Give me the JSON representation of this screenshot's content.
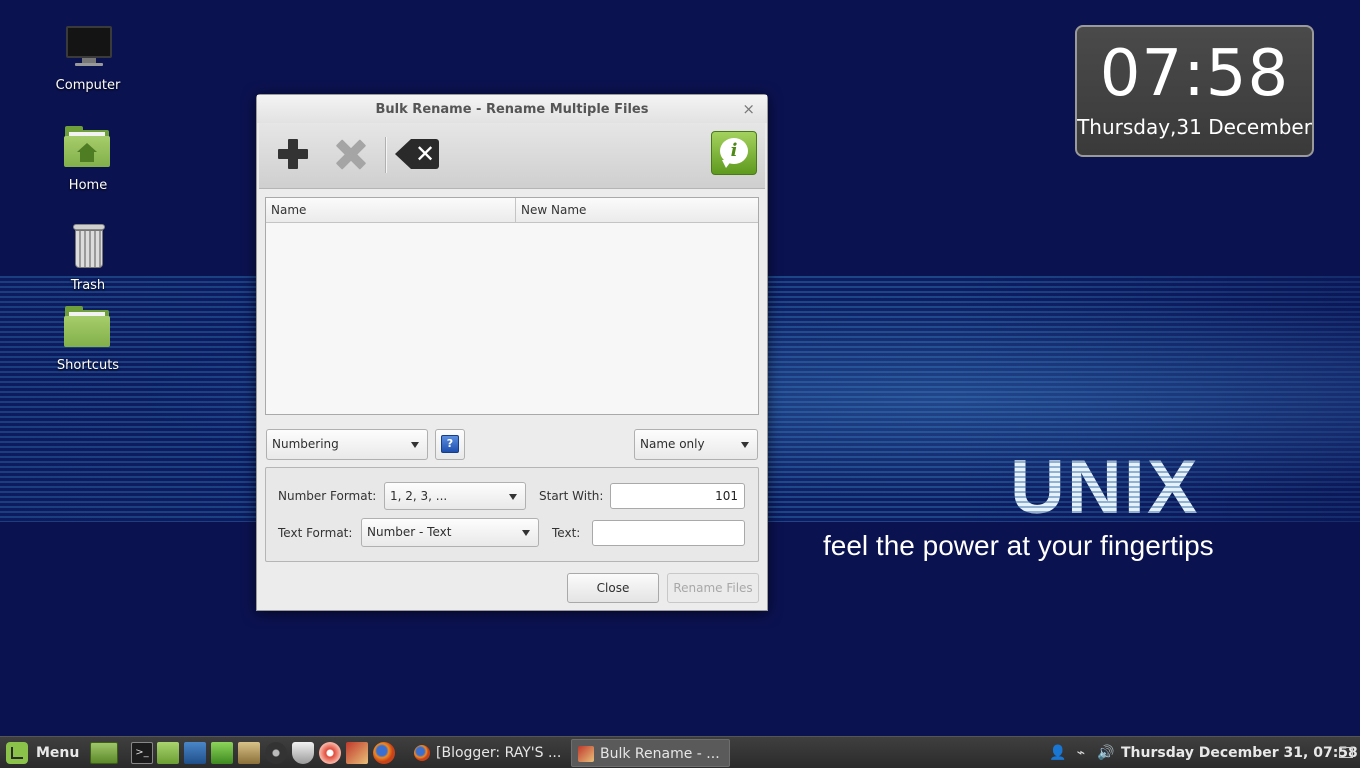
{
  "desktop": {
    "icons": [
      {
        "label": "Computer",
        "icon": "monitor-icon"
      },
      {
        "label": "Home",
        "icon": "home-folder-icon"
      },
      {
        "label": "Trash",
        "icon": "trash-icon"
      },
      {
        "label": "Shortcuts",
        "icon": "folder-icon"
      }
    ],
    "wallpaper": {
      "title": "UNIX",
      "tagline": "feel the power at your fingertips",
      "background_color": "#0b1250",
      "stripe_color": "#1e4c8c"
    }
  },
  "clock_widget": {
    "time": "07:58",
    "date": "Thursday,31 December"
  },
  "dialog": {
    "title": "Bulk Rename - Rename Multiple Files",
    "close_glyph": "×",
    "toolbar": {
      "add_icon": "plus-icon",
      "remove_icon": "x-icon",
      "clear_icon": "backspace-icon",
      "info_icon": "info-bubble-icon",
      "info_glyph": "i"
    },
    "file_list": {
      "columns": [
        "Name",
        "New Name"
      ],
      "rows": []
    },
    "rename_mode": "Numbering",
    "help_glyph": "?",
    "apply_to": "Name only",
    "numbering": {
      "number_format_label": "Number Format:",
      "number_format_value": "1, 2, 3, ...",
      "start_with_label": "Start With:",
      "start_with_value": "101",
      "text_format_label": "Text Format:",
      "text_format_value": "Number - Text",
      "text_label": "Text:",
      "text_value": ""
    },
    "buttons": {
      "close": "Close",
      "rename": "Rename Files"
    }
  },
  "taskbar": {
    "menu_label": "Menu",
    "launchers": [
      "show-desktop-icon",
      "terminal-icon",
      "files-icon",
      "media-player-icon",
      "software-manager-icon",
      "image-viewer-icon",
      "disk-utility-icon",
      "firewall-icon",
      "disc-burner-icon",
      "bulk-rename-icon",
      "firefox-icon"
    ],
    "windows": [
      {
        "label": "[Blogger: RAY'S ...",
        "icon": "firefox-icon",
        "active": false
      },
      {
        "label": "Bulk Rename - ...",
        "icon": "bulk-rename-icon",
        "active": true
      }
    ],
    "tray": [
      "user-icon",
      "network-icon",
      "volume-icon"
    ],
    "clock": "Thursday December 31, 07:58",
    "workspace_icon": "window-list-icon"
  }
}
